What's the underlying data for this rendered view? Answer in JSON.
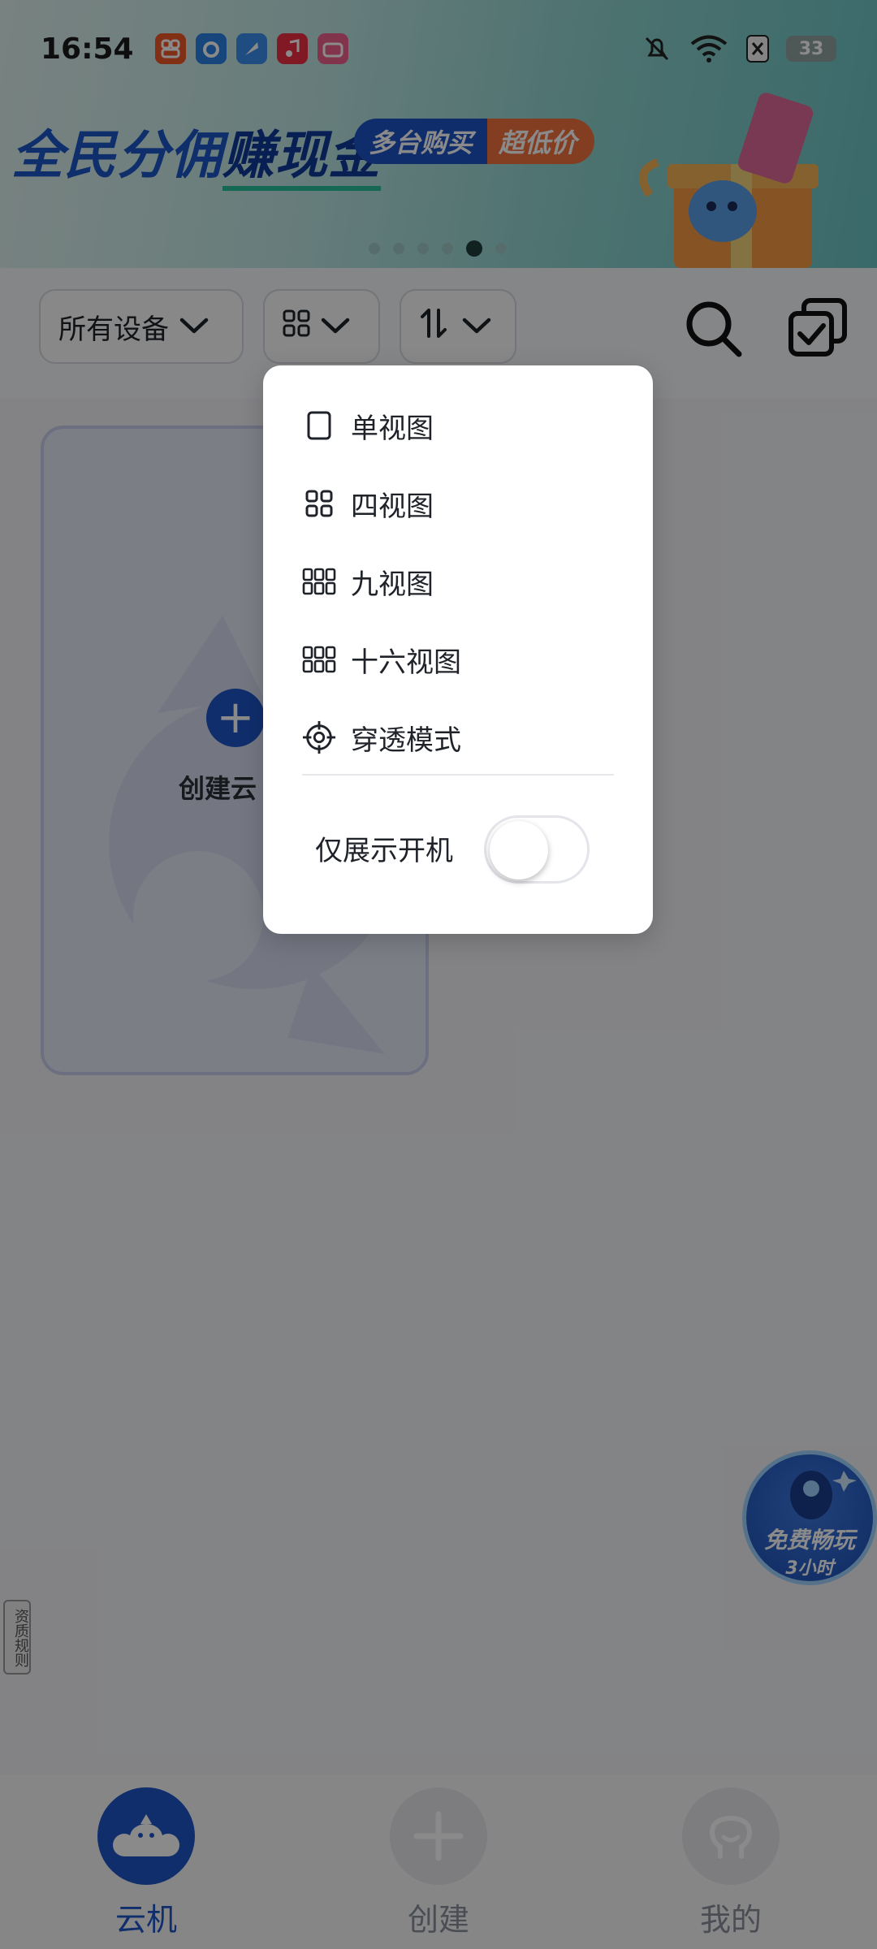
{
  "status_bar": {
    "time": "16:54",
    "battery": "33",
    "notification_apps": [
      "app-store-icon",
      "browser-icon",
      "feather-icon",
      "music-icon",
      "bilibili-icon"
    ],
    "status_icons": [
      "mute-icon",
      "wifi-icon",
      "sim-off-icon"
    ]
  },
  "banner": {
    "title_prefix": "全民分佣",
    "title_highlight": "赚现金",
    "pill_left": "多台购买",
    "pill_right": "超低价",
    "page_count": 6,
    "active_page": 5
  },
  "toolbar": {
    "device_filter_label": "所有设备",
    "view_icon": "grid-icon",
    "sort_icon": "sort-icon",
    "search_icon": "search-icon",
    "multi_select_icon": "multi-select-icon"
  },
  "create_card": {
    "label": "创建云"
  },
  "view_menu": {
    "items": [
      {
        "label": "单视图",
        "icon": "single-view-icon"
      },
      {
        "label": "四视图",
        "icon": "four-view-icon"
      },
      {
        "label": "九视图",
        "icon": "nine-view-icon"
      },
      {
        "label": "十六视图",
        "icon": "sixteen-view-icon"
      },
      {
        "label": "穿透模式",
        "icon": "crosshair-icon"
      }
    ],
    "toggle_label": "仅展示开机",
    "toggle_on": false
  },
  "side_tag": "资质规则",
  "promo_badge": {
    "line1": "免费畅玩",
    "line2": "3小时"
  },
  "bottom_nav": {
    "items": [
      {
        "label": "云机",
        "active": true
      },
      {
        "label": "创建",
        "active": false
      },
      {
        "label": "我的",
        "active": false
      }
    ]
  },
  "colors": {
    "brand_blue": "#1e55c8",
    "accent_orange": "#f2723c",
    "banner_green": "#8fd4d0"
  }
}
